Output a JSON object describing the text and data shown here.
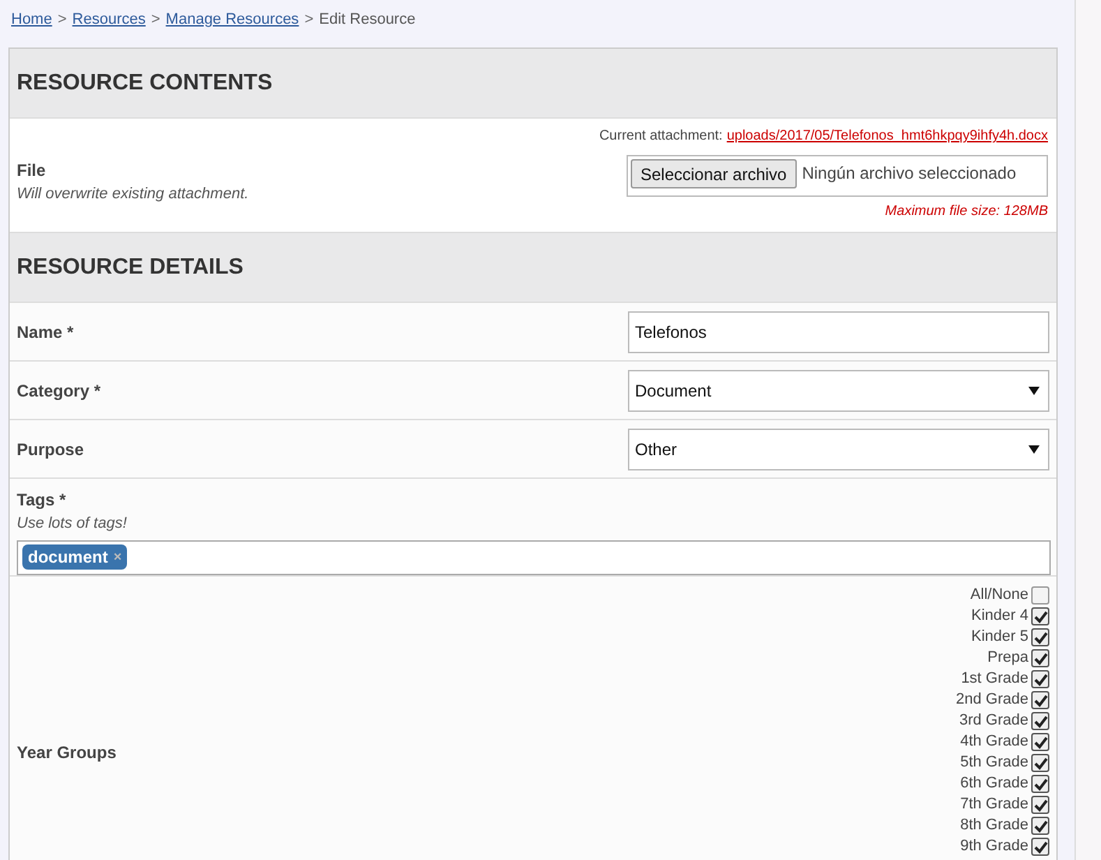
{
  "breadcrumb": [
    {
      "label": "Home",
      "link": true
    },
    {
      "label": "Resources",
      "link": true
    },
    {
      "label": "Manage Resources",
      "link": true
    },
    {
      "label": "Edit Resource",
      "link": false
    }
  ],
  "separator": ">",
  "contents": {
    "heading": "RESOURCE CONTENTS",
    "file": {
      "label": "File",
      "hint": "Will overwrite existing attachment.",
      "current_label": "Current attachment:",
      "current_link": "uploads/2017/05/Telefonos_hmt6hkpqy9ihfy4h.docx",
      "button": "Seleccionar archivo",
      "status": "Ningún archivo seleccionado",
      "max_size": "Maximum file size: 128MB"
    }
  },
  "details": {
    "heading": "RESOURCE DETAILS",
    "fields": [
      {
        "kind": "text",
        "label": "Name *",
        "value": "Telefonos"
      },
      {
        "kind": "select",
        "label": "Category *",
        "value": "Document"
      },
      {
        "kind": "select",
        "label": "Purpose",
        "value": "Other"
      }
    ],
    "tags": {
      "label": "Tags *",
      "hint": "Use lots of tags!",
      "items": [
        {
          "label": "document",
          "remove": "×"
        }
      ]
    },
    "year_groups": {
      "label": "Year Groups",
      "options": [
        {
          "label": "All/None",
          "checked": false
        },
        {
          "label": "Kinder 4",
          "checked": true
        },
        {
          "label": "Kinder 5",
          "checked": true
        },
        {
          "label": "Prepa",
          "checked": true
        },
        {
          "label": "1st Grade",
          "checked": true
        },
        {
          "label": "2nd Grade",
          "checked": true
        },
        {
          "label": "3rd Grade",
          "checked": true
        },
        {
          "label": "4th Grade",
          "checked": true
        },
        {
          "label": "5th Grade",
          "checked": true
        },
        {
          "label": "6th Grade",
          "checked": true
        },
        {
          "label": "7th Grade",
          "checked": true
        },
        {
          "label": "8th Grade",
          "checked": true
        },
        {
          "label": "9th Grade",
          "checked": true
        }
      ]
    }
  }
}
